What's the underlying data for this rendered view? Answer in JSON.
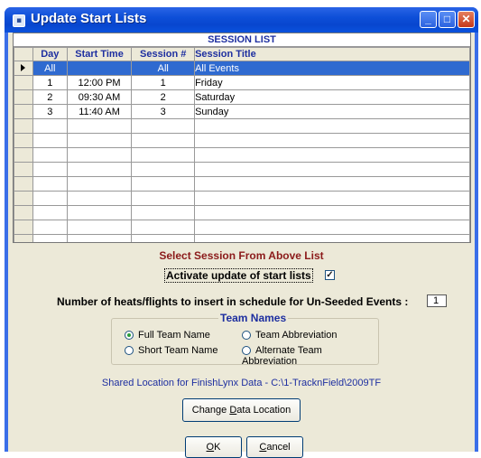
{
  "window": {
    "title": "Update Start Lists",
    "controls": [
      "minimize",
      "maximize",
      "close"
    ]
  },
  "session_list": {
    "caption": "SESSION LIST",
    "columns": [
      "Day",
      "Start Time",
      "Session #",
      "Session Title"
    ],
    "rows": [
      {
        "day": "All",
        "start_time": "",
        "session": "All",
        "title": "All Events",
        "selected": true
      },
      {
        "day": "1",
        "start_time": "12:00 PM",
        "session": "1",
        "title": "Friday",
        "selected": false
      },
      {
        "day": "2",
        "start_time": "09:30 AM",
        "session": "2",
        "title": "Saturday",
        "selected": false
      },
      {
        "day": "3",
        "start_time": "11:40 AM",
        "session": "3",
        "title": "Sunday",
        "selected": false
      }
    ],
    "empty_rows": 9
  },
  "select_label": "Select Session From Above List",
  "activate": {
    "label": "Activate update of start lists",
    "checked": true,
    "check_glyph": "✓"
  },
  "heats": {
    "label": "Number of heats/flights to insert in schedule for Un-Seeded Events :",
    "value": "1"
  },
  "team_names": {
    "legend": "Team Names",
    "options": [
      {
        "label": "Full Team Name",
        "checked": true
      },
      {
        "label": "Team Abbreviation",
        "checked": false
      },
      {
        "label": "Short Team Name",
        "checked": false
      },
      {
        "label": "Alternate Team Abbreviation",
        "checked": false
      }
    ]
  },
  "shared_location": "Shared Location for FinishLynx Data  -  C:\\1-TracknField\\2009TF",
  "buttons": {
    "change_pre": "Change ",
    "change_ul": "D",
    "change_post": "ata Location",
    "ok_ul": "O",
    "ok_post": "K",
    "cancel_ul": "C",
    "cancel_post": "ancel"
  },
  "colors": {
    "titlebar": "#0846cf",
    "selection": "#2f6ad0",
    "header_text": "#1e2fa0",
    "prompt_text": "#8b1a1a"
  }
}
